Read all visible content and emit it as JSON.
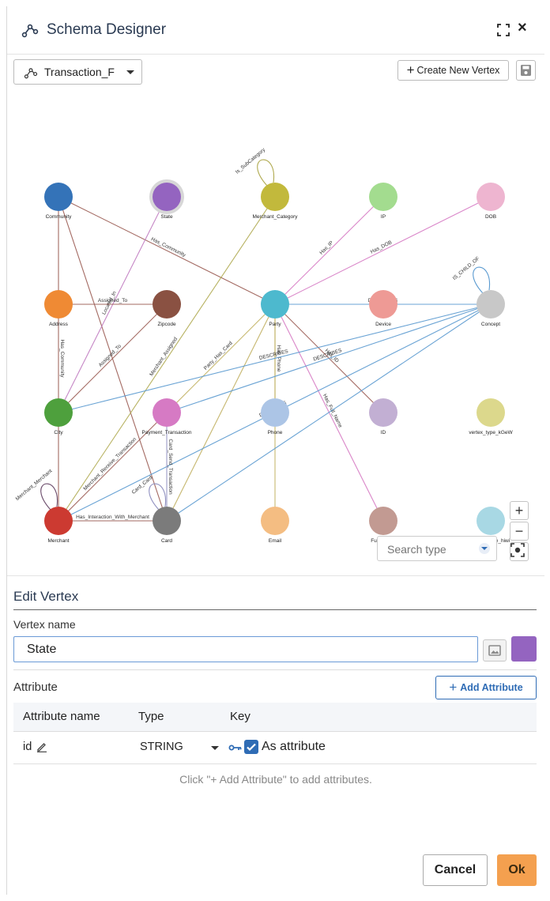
{
  "header": {
    "title": "Schema Designer",
    "close_label": "×"
  },
  "toolbar": {
    "graph_name": "Transaction_F",
    "create_vertex_label": "Create New Vertex"
  },
  "graph": {
    "vertices": [
      {
        "id": "community",
        "label": "Community",
        "color": "#3473b8",
        "col": 0,
        "row": 0
      },
      {
        "id": "state",
        "label": "State",
        "color": "#9464c0",
        "col": 1,
        "row": 0,
        "selected": true
      },
      {
        "id": "merchant_category",
        "label": "Merchant_Category",
        "color": "#c2b93c",
        "col": 2,
        "row": 0
      },
      {
        "id": "ip",
        "label": "IP",
        "color": "#a3dc8f",
        "col": 3,
        "row": 0
      },
      {
        "id": "dob",
        "label": "DOB",
        "color": "#eeb5d0",
        "col": 4,
        "row": 0
      },
      {
        "id": "address",
        "label": "Address",
        "color": "#ef8a34",
        "col": 0,
        "row": 1
      },
      {
        "id": "zipcode",
        "label": "Zipcode",
        "color": "#8a5142",
        "col": 1,
        "row": 1
      },
      {
        "id": "party",
        "label": "Party",
        "color": "#4db9ce",
        "col": 2,
        "row": 1
      },
      {
        "id": "device",
        "label": "Device",
        "color": "#ee9a95",
        "col": 3,
        "row": 1
      },
      {
        "id": "concept",
        "label": "Concept",
        "color": "#c8c8c8",
        "col": 4,
        "row": 1
      },
      {
        "id": "city",
        "label": "City",
        "color": "#4ea03d",
        "col": 0,
        "row": 2
      },
      {
        "id": "payment_transaction",
        "label": "Payment_Transaction",
        "color": "#d67ac4",
        "col": 1,
        "row": 2
      },
      {
        "id": "phone",
        "label": "Phone",
        "color": "#acc5e6",
        "col": 2,
        "row": 2
      },
      {
        "id": "id_v",
        "label": "ID",
        "color": "#c2afd3",
        "col": 3,
        "row": 2
      },
      {
        "id": "vertex_type_kgew",
        "label": "vertex_type_kGeW",
        "color": "#dcd88c",
        "col": 4,
        "row": 2
      },
      {
        "id": "merchant",
        "label": "Merchant",
        "color": "#cc3a31",
        "col": 0,
        "row": 3
      },
      {
        "id": "card",
        "label": "Card",
        "color": "#7b7b7b",
        "col": 1,
        "row": 3
      },
      {
        "id": "email",
        "label": "Email",
        "color": "#f4bd82",
        "col": 2,
        "row": 3
      },
      {
        "id": "full_name",
        "label": "Full_Name",
        "color": "#c29a92",
        "col": 3,
        "row": 3
      },
      {
        "id": "vertex_type_hiw",
        "label": "vertex_type_hiwi",
        "color": "#a8d8e4",
        "col": 4,
        "row": 3
      }
    ],
    "edges": [
      {
        "from": "community",
        "to": "party",
        "label": "Has_Community",
        "color": "#9a5a52"
      },
      {
        "from": "community",
        "to": "address",
        "label": "",
        "color": "#9a5a52"
      },
      {
        "from": "community",
        "to": "card",
        "label": "",
        "color": "#9a5a52"
      },
      {
        "from": "state",
        "to": "city",
        "label": "Located_In",
        "color": "#c07bc0"
      },
      {
        "from": "merchant_category",
        "to": "merchant",
        "label": "Merchant_Assigned",
        "color": "#b0aa50"
      },
      {
        "from": "ip",
        "to": "party",
        "label": "Has_IP",
        "color": "#d67ac4"
      },
      {
        "from": "dob",
        "to": "party",
        "label": "Has_DOB",
        "color": "#d67ac4"
      },
      {
        "from": "address",
        "to": "zipcode",
        "label": "Assigned_To",
        "color": "#9a5a52"
      },
      {
        "from": "address",
        "to": "city",
        "label": "Has_Community",
        "color": "#9a5a52"
      },
      {
        "from": "zipcode",
        "to": "city",
        "label": "Assigned_To",
        "color": "#9a5a52"
      },
      {
        "from": "party",
        "to": "concept",
        "label": "DESCRIBES",
        "color": "#5a9ad0"
      },
      {
        "from": "party",
        "to": "phone",
        "label": "Has_Phone",
        "color": "#c0b060"
      },
      {
        "from": "party",
        "to": "id_v",
        "label": "Has_ID",
        "color": "#9a5a52"
      },
      {
        "from": "party",
        "to": "full_name",
        "label": "Has_Full_Name",
        "color": "#d67ac4"
      },
      {
        "from": "party",
        "to": "payment_transaction",
        "label": "Party_Has_Card",
        "color": "#c0b060"
      },
      {
        "from": "party",
        "to": "email",
        "label": "",
        "color": "#c0b060"
      },
      {
        "from": "party",
        "to": "card",
        "label": "",
        "color": "#c0b060"
      },
      {
        "from": "concept",
        "to": "city",
        "label": "DESCRIBES",
        "color": "#5a9ad0"
      },
      {
        "from": "concept",
        "to": "payment_transaction",
        "label": "DESCRIBES",
        "color": "#5a9ad0"
      },
      {
        "from": "concept",
        "to": "merchant",
        "label": "DESCRIBES",
        "color": "#5a9ad0"
      },
      {
        "from": "concept",
        "to": "card",
        "label": "",
        "color": "#5a9ad0"
      },
      {
        "from": "payment_transaction",
        "to": "merchant",
        "label": "Merchant_Receive_Transaction",
        "color": "#9a5a52"
      },
      {
        "from": "payment_transaction",
        "to": "card",
        "label": "Card_Send_Transaction",
        "color": "#9090c0"
      },
      {
        "from": "merchant",
        "to": "card",
        "label": "Has_Interaction_With_Merchant",
        "color": "#9a5a52"
      },
      {
        "from": "city",
        "to": "merchant",
        "label": "",
        "color": "#9a5a52"
      }
    ],
    "self_loops": [
      {
        "node": "merchant_category",
        "label": "Is_SubCategory",
        "color": "#b0aa50"
      },
      {
        "node": "concept",
        "label": "IS_CHILD_OF",
        "color": "#5a9ad0"
      },
      {
        "node": "merchant",
        "label": "Merchant_Merchant",
        "color": "#6a4a6a"
      },
      {
        "node": "card",
        "label": "Card_Card",
        "color": "#9090c0"
      }
    ],
    "search_placeholder": "Search type",
    "zoom_in_label": "+",
    "zoom_out_label": "−"
  },
  "edit_vertex": {
    "title": "Edit Vertex",
    "vertex_name_label": "Vertex name",
    "vertex_name_value": "State",
    "vertex_color": "#9464c0",
    "attribute_label": "Attribute",
    "add_attribute_label": "Add Attribute",
    "table": {
      "headers": [
        "Attribute name",
        "Type",
        "Key"
      ],
      "rows": [
        {
          "name": "id",
          "type": "STRING",
          "key_label": "As attribute",
          "checked": true
        }
      ]
    },
    "hint": "Click \"+ Add Attribute\" to add attributes.",
    "cancel_label": "Cancel",
    "ok_label": "Ok"
  }
}
